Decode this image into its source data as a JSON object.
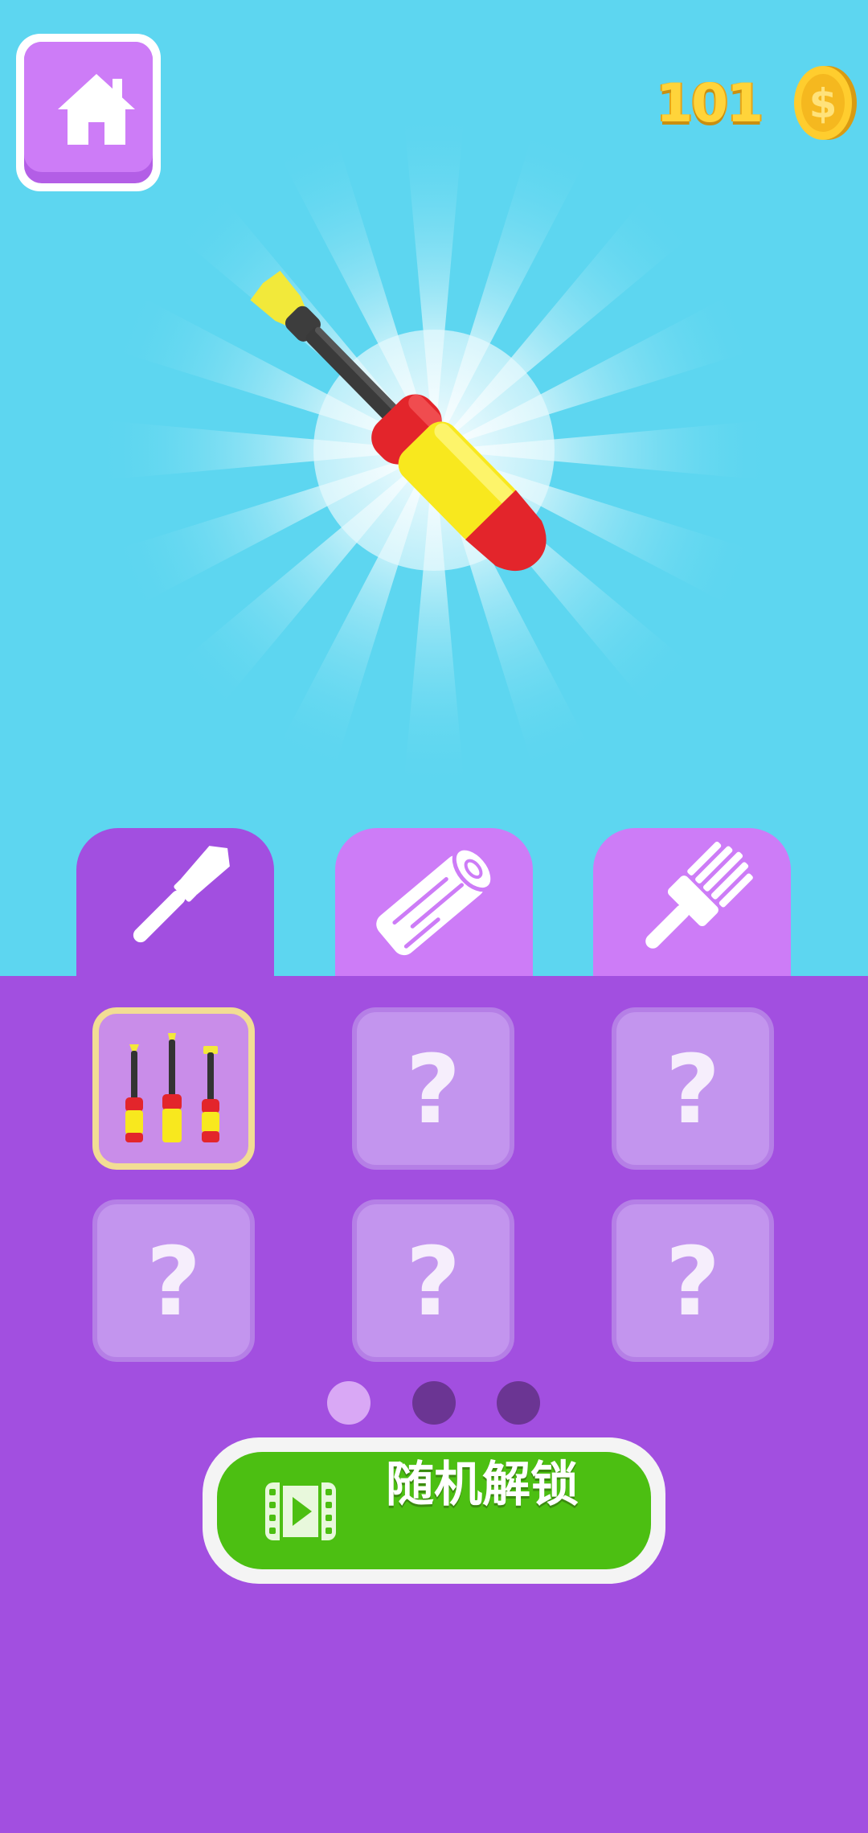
{
  "hud": {
    "home_icon": "house-icon",
    "coin_count": "101",
    "coin_icon": "dollar-coin-icon"
  },
  "showcase": {
    "tool_icon": "screwdriver-icon"
  },
  "tabs": [
    {
      "icon": "chisel-icon",
      "active": true
    },
    {
      "icon": "wood-log-icon",
      "active": false
    },
    {
      "icon": "paint-brush-icon",
      "active": false
    }
  ],
  "grid": {
    "items": [
      {
        "state": "unlocked",
        "icon": "screwdriver-set-icon",
        "label": ""
      },
      {
        "state": "locked",
        "label": "?"
      },
      {
        "state": "locked",
        "label": "?"
      },
      {
        "state": "locked",
        "label": "?"
      },
      {
        "state": "locked",
        "label": "?"
      },
      {
        "state": "locked",
        "label": "?"
      }
    ]
  },
  "pagination": {
    "pages": 3,
    "current": 1
  },
  "unlock_button": {
    "label": "随机解锁",
    "icon": "video-film-icon"
  },
  "colors": {
    "sky": "#5dd6f0",
    "panel": "#a24fe0",
    "tab_inactive": "#cd7cf7",
    "button_green": "#4cbf12",
    "coin_gold": "#ffd43a"
  }
}
